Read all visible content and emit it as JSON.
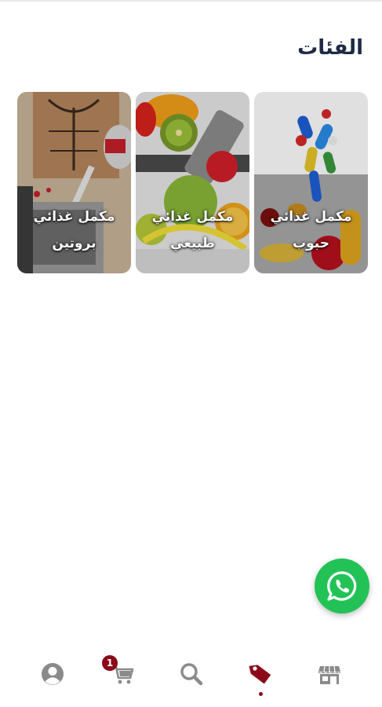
{
  "header": {
    "title": "الفئات"
  },
  "categories": [
    {
      "line1": "مكمل غذائي",
      "line2": "حبوب",
      "image": "pills-icon"
    },
    {
      "line1": "مكمل غذائي",
      "line2": "طبيعي",
      "image": "fruits-dumbbell-icon"
    },
    {
      "line1": "مكمل غذائي",
      "line2": "بروتين",
      "image": "protein-shaker-icon"
    }
  ],
  "fab": {
    "icon": "whatsapp-icon",
    "color": "#23c257"
  },
  "bottom_nav": {
    "items": [
      {
        "icon": "store-icon"
      },
      {
        "icon": "tag-icon",
        "active": true
      },
      {
        "icon": "search-icon"
      },
      {
        "icon": "cart-icon",
        "badge": "1"
      },
      {
        "icon": "user-icon"
      }
    ],
    "active_color": "#8b0a1a",
    "inactive_color": "#8a8a8a"
  }
}
